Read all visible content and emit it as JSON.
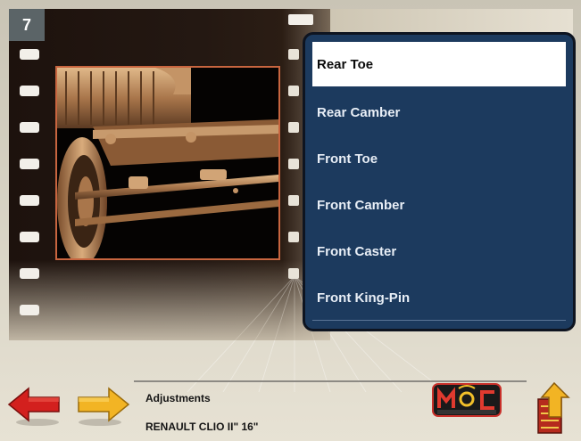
{
  "step": {
    "number": "7"
  },
  "menu": {
    "items": [
      {
        "label": "Rear Toe",
        "selected": true
      },
      {
        "label": "Rear Camber",
        "selected": false
      },
      {
        "label": "Front Toe",
        "selected": false
      },
      {
        "label": "Front Camber",
        "selected": false
      },
      {
        "label": "Front Caster",
        "selected": false
      },
      {
        "label": "Front King-Pin",
        "selected": false
      }
    ]
  },
  "footer": {
    "section_title": "Adjustments",
    "vehicle": "RENAULT CLIO II\" 16\""
  },
  "icons": {
    "back": "arrow-left-icon",
    "forward": "arrow-right-icon",
    "logo": "mondolfo-ferro-logo",
    "exit": "exit-icon"
  },
  "colors": {
    "menu_bg": "#1c3a5e",
    "menu_selected_bg": "#ffffff",
    "photo_border": "#c8653f",
    "back_arrow": "#d3201e",
    "forward_arrow": "#f2b424",
    "step_badge_bg": "#5b6467"
  },
  "logo": {
    "text": "MONDOLFO FERRO"
  }
}
